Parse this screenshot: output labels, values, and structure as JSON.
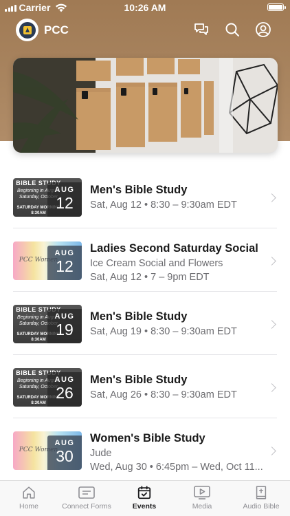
{
  "status_bar": {
    "carrier": "Carrier",
    "time": "10:26 AM"
  },
  "app_bar": {
    "title": "PCC"
  },
  "events": [
    {
      "title": "Men's Bible Study",
      "line1": "Sat, Aug 12 • 8:30 – 9:30am EDT",
      "line2": "",
      "month": "AUG",
      "day": "12",
      "thumb": "dark"
    },
    {
      "title": "Ladies Second Saturday Social",
      "line1": "Ice Cream Social and Flowers",
      "line2": "Sat, Aug 12 • 7 – 9pm EDT",
      "month": "AUG",
      "day": "12",
      "thumb": "rainbow"
    },
    {
      "title": "Men's Bible Study",
      "line1": "Sat, Aug 19 • 8:30 – 9:30am EDT",
      "line2": "",
      "month": "AUG",
      "day": "19",
      "thumb": "dark"
    },
    {
      "title": "Men's Bible Study",
      "line1": "Sat, Aug 26 • 8:30 – 9:30am EDT",
      "line2": "",
      "month": "AUG",
      "day": "26",
      "thumb": "dark"
    },
    {
      "title": "Women's Bible Study",
      "line1": "Jude",
      "line2": "Wed, Aug 30 • 6:45pm – Wed, Oct 11...",
      "month": "AUG",
      "day": "30",
      "thumb": "rainbow"
    }
  ],
  "thumbnail_text": {
    "dark_heading": "BIBLE STUDY",
    "dark_line1": "Beginning in August",
    "dark_line2": "Saturday, October",
    "dark_line3": "SATURDAY MORNING",
    "dark_line4": "8:30AM",
    "rainbow_script": "PCC Women"
  },
  "tabs": [
    {
      "label": "Home",
      "icon": "home-icon"
    },
    {
      "label": "Connect Forms",
      "icon": "form-icon"
    },
    {
      "label": "Events",
      "icon": "calendar-icon"
    },
    {
      "label": "Media",
      "icon": "media-icon"
    },
    {
      "label": "Audio Bible",
      "icon": "bible-icon"
    }
  ],
  "active_tab": "Events",
  "colors": {
    "header_brown": "#a98560",
    "tab_active": "#1c1c1e",
    "tab_inactive": "#8e8e93"
  }
}
